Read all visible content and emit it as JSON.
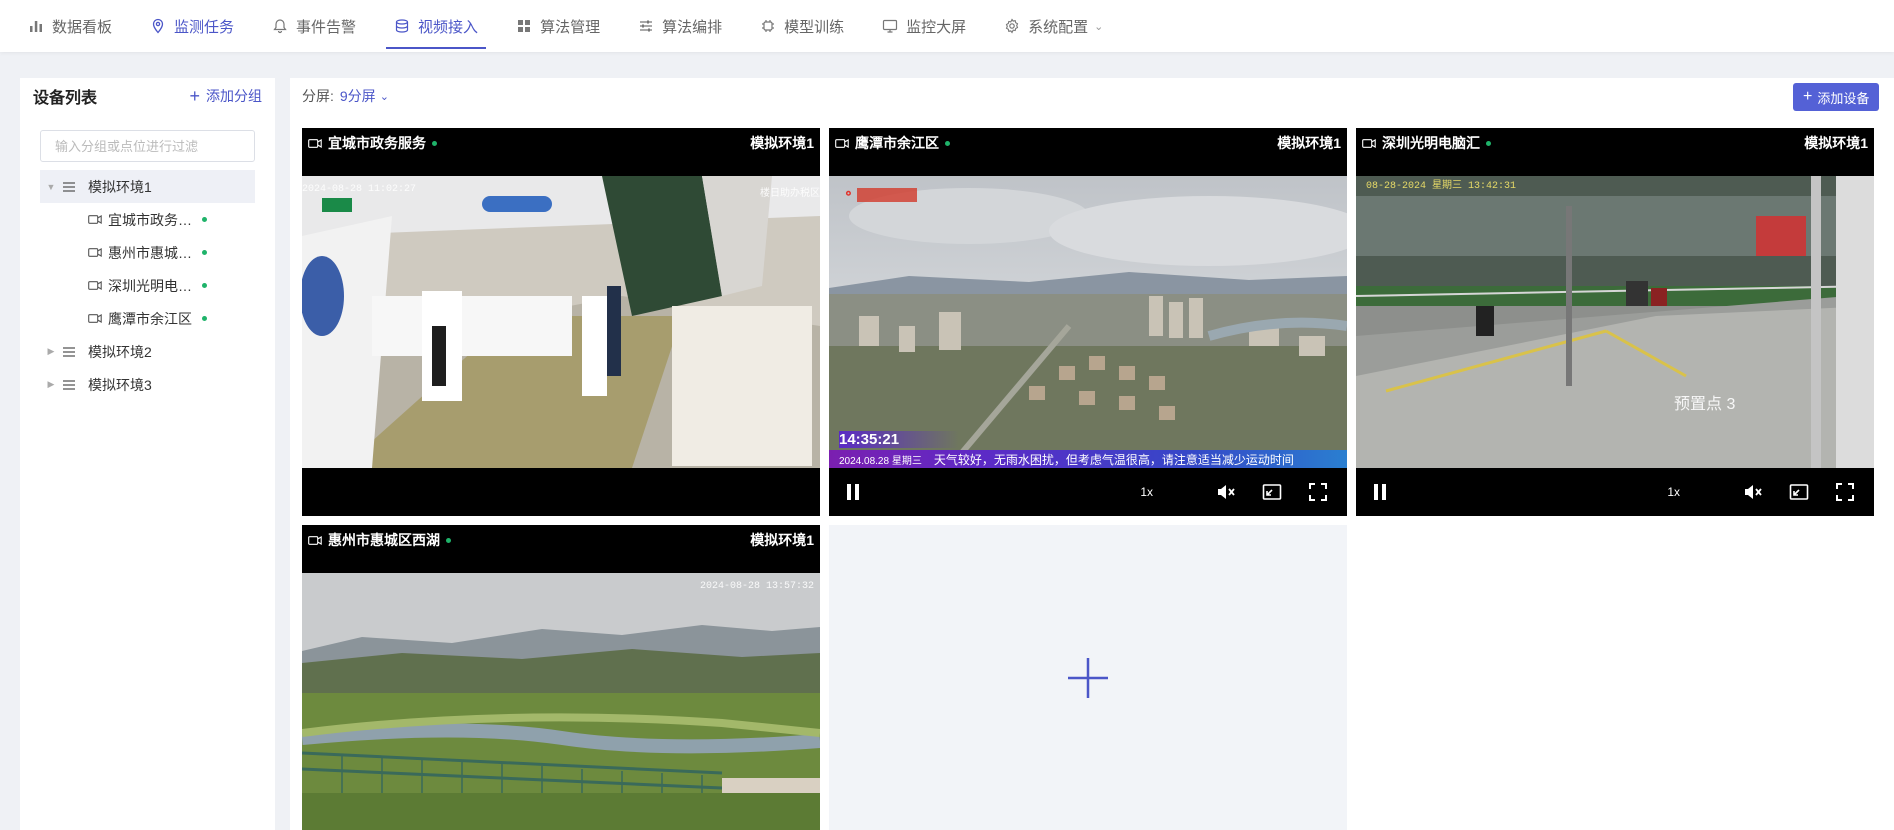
{
  "nav": {
    "items": [
      {
        "label": "数据看板",
        "icon": "bar-chart-icon",
        "active": false
      },
      {
        "label": "监测任务",
        "icon": "location-pin-icon",
        "active": false
      },
      {
        "label": "事件告警",
        "icon": "bell-icon",
        "active": false
      },
      {
        "label": "视频接入",
        "icon": "database-icon",
        "active": true
      },
      {
        "label": "算法管理",
        "icon": "grid-icon",
        "active": false
      },
      {
        "label": "算法编排",
        "icon": "sliders-icon",
        "active": false
      },
      {
        "label": "模型训练",
        "icon": "chip-icon",
        "active": false
      },
      {
        "label": "监控大屏",
        "icon": "monitor-icon",
        "active": false
      },
      {
        "label": "系统配置",
        "icon": "gear-icon",
        "active": false,
        "dropdown": true
      }
    ],
    "accent": "#4b56c8"
  },
  "sidebar": {
    "title": "设备列表",
    "add_group_label": "添加分组",
    "search_placeholder": "输入分组或点位进行过滤",
    "tree": [
      {
        "label": "模拟环境1",
        "expanded": true,
        "selected": true,
        "children": [
          {
            "label": "宜城市政务…",
            "online": true
          },
          {
            "label": "惠州市惠城…",
            "online": true
          },
          {
            "label": "深圳光明电…",
            "online": true
          },
          {
            "label": "鹰潭市余江区",
            "online": true
          }
        ]
      },
      {
        "label": "模拟环境2",
        "expanded": false
      },
      {
        "label": "模拟环境3",
        "expanded": false
      }
    ]
  },
  "main": {
    "split_label": "分屏:",
    "split_value": "9分屏",
    "add_device_label": "添加设备",
    "tiles": [
      {
        "name": "宜城市政务服务",
        "env": "模拟环境1",
        "online": true,
        "timestamp": "2024-08-28 11:02:27",
        "overlay": "楼日助办税区"
      },
      {
        "name": "鹰潭市余江区",
        "env": "模拟环境1",
        "online": true,
        "time": "14:35:21",
        "date": "2024.08.28 星期三",
        "ticker": "天气较好，无雨水困扰，但考虑气温很高，请注意适当减少运动时间",
        "rate": "1x"
      },
      {
        "name": "深圳光明电脑汇",
        "env": "模拟环境1",
        "online": true,
        "timestamp": "08-28-2024 星期三 13:42:31",
        "preset": "预置点 3",
        "rate": "1x"
      },
      {
        "name": "惠州市惠城区西湖",
        "env": "模拟环境1",
        "online": true,
        "timestamp": "2024-08-28 13:57:32"
      }
    ],
    "status_color": "#1fb36a"
  }
}
